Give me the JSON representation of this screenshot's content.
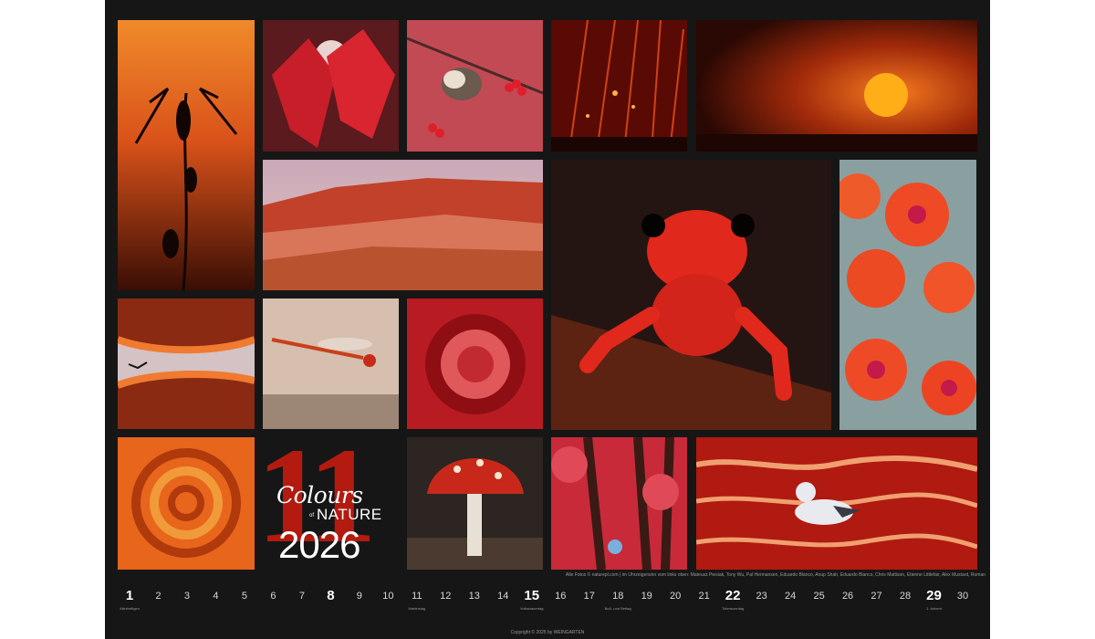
{
  "title": {
    "month_number": "11",
    "colours": "Colours",
    "of": "of",
    "nature": "NATURE",
    "year": "2026"
  },
  "photo_credits": "Alle Fotos © naturepl.com | im Uhrzeigersinn vom links oben: Mateusz Piesiak, Tony Wu, Pal Hermansen, Eduardo Blanco, Anup Shah, Eduardo Blanco, Chris Mattison, Etienne Littlefair, Alex Mustard, Roman Willi, Jack Dykinga, Chris Mattison, Guy Edwardes, Tony Wu, David Tipling",
  "copyright": "Copyright © 2025 by WEINGARTEN",
  "calendar": {
    "days": [
      "1",
      "2",
      "3",
      "4",
      "5",
      "6",
      "7",
      "8",
      "9",
      "10",
      "11",
      "12",
      "13",
      "14",
      "15",
      "16",
      "17",
      "18",
      "19",
      "20",
      "21",
      "22",
      "23",
      "24",
      "25",
      "26",
      "27",
      "28",
      "29",
      "30"
    ],
    "sundays": [
      "1",
      "8",
      "15",
      "22",
      "29"
    ],
    "holidays": {
      "1": "Allerheiligen",
      "11": "Martinstag",
      "15": "Volkstrauertag",
      "18": "Buß- und Bettag",
      "22": "Totensonntag",
      "29": "1. Advent"
    }
  },
  "photos": [
    {
      "name": "dragonfly-silhouette-photo"
    },
    {
      "name": "red-maple-leaves-photo"
    },
    {
      "name": "bird-berries-photo"
    },
    {
      "name": "lava-sparks-photo"
    },
    {
      "name": "sunset-photo"
    },
    {
      "name": "painted-desert-photo"
    },
    {
      "name": "red-frog-photo"
    },
    {
      "name": "cactus-flowers-photo"
    },
    {
      "name": "red-clouds-bird-photo"
    },
    {
      "name": "red-dragonfly-photo"
    },
    {
      "name": "sea-anemone-photo"
    },
    {
      "name": "chameleon-tail-photo"
    },
    {
      "name": "fly-agaric-photo"
    },
    {
      "name": "red-forest-photo"
    },
    {
      "name": "gull-red-water-photo"
    }
  ]
}
